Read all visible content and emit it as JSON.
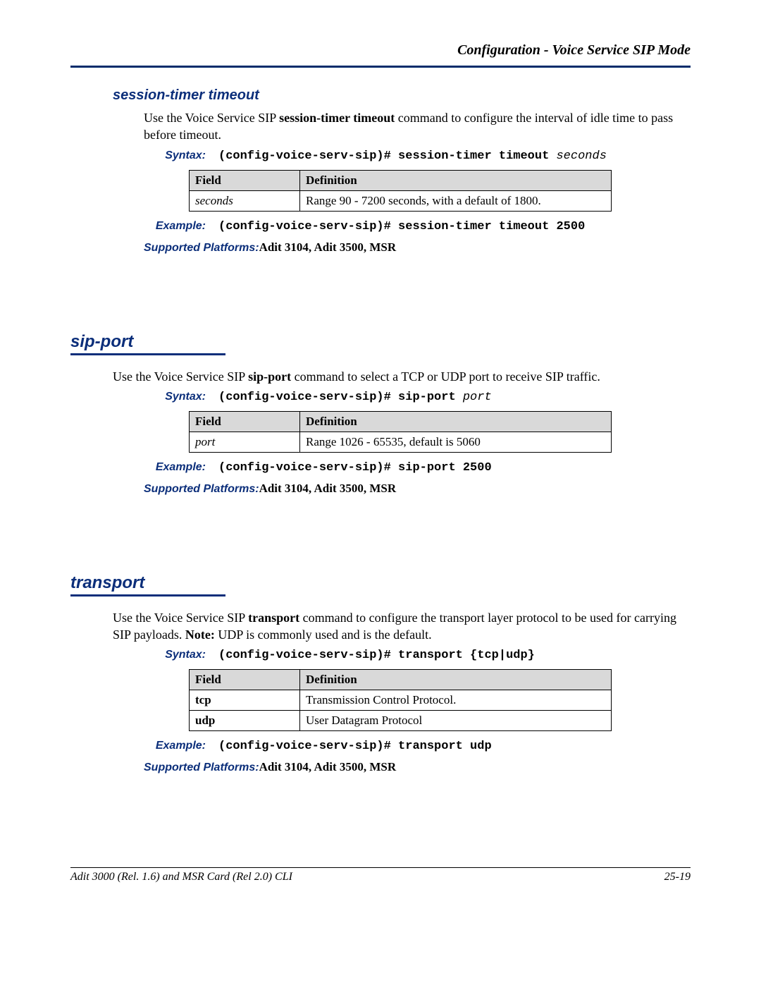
{
  "header": {
    "title": "Configuration - Voice Service SIP Mode"
  },
  "sections": {
    "sessionTimer": {
      "title": "session-timer timeout",
      "desc_pre": "Use the Voice Service SIP ",
      "desc_bold": "session-timer timeout",
      "desc_post": " command to configure the interval of idle time to pass before timeout.",
      "syntaxLabel": "Syntax:",
      "syntaxCmd": "(config-voice-serv-sip)# session-timer timeout ",
      "syntaxArg": "seconds",
      "table": {
        "h1": "Field",
        "h2": "Definition",
        "r1c1": "seconds",
        "r1c2": "Range 90 - 7200 seconds, with a default of 1800."
      },
      "exampleLabel": "Example:",
      "exampleCmd": "(config-voice-serv-sip)# session-timer timeout 2500",
      "platformsLabel": "Supported Platforms:  ",
      "platforms": "Adit 3104, Adit 3500, MSR"
    },
    "sipPort": {
      "title": "sip-port",
      "desc_pre": "Use the Voice Service SIP ",
      "desc_bold": "sip-port",
      "desc_post": " command to select a TCP or UDP port to receive SIP traffic.",
      "syntaxLabel": "Syntax:",
      "syntaxCmd": "(config-voice-serv-sip)# sip-port ",
      "syntaxArg": "port",
      "table": {
        "h1": "Field",
        "h2": "Definition",
        "r1c1": "port",
        "r1c2": "Range 1026 - 65535, default is 5060"
      },
      "exampleLabel": "Example:",
      "exampleCmd": "(config-voice-serv-sip)# sip-port 2500",
      "platformsLabel": "Supported Platforms:  ",
      "platforms": "Adit 3104, Adit 3500, MSR"
    },
    "transport": {
      "title": "transport",
      "desc_pre": "Use the Voice Service SIP ",
      "desc_bold": "transport",
      "desc_post1": " command to configure the transport layer protocol to be used for carrying SIP payloads. ",
      "desc_noteLabel": "Note:",
      "desc_post2": " UDP is commonly used and is the default.",
      "syntaxLabel": "Syntax:",
      "syntaxCmd": "(config-voice-serv-sip)# transport {tcp|udp}",
      "table": {
        "h1": "Field",
        "h2": "Definition",
        "r1c1": "tcp",
        "r1c2": "Transmission Control Protocol.",
        "r2c1": "udp",
        "r2c2": "User Datagram Protocol"
      },
      "exampleLabel": "Example:",
      "exampleCmd": "(config-voice-serv-sip)# transport udp",
      "platformsLabel": "Supported Platforms:  ",
      "platforms": "Adit 3104, Adit 3500, MSR"
    }
  },
  "footer": {
    "left": "Adit 3000 (Rel. 1.6) and MSR Card (Rel 2.0) CLI",
    "right": "25-19"
  }
}
